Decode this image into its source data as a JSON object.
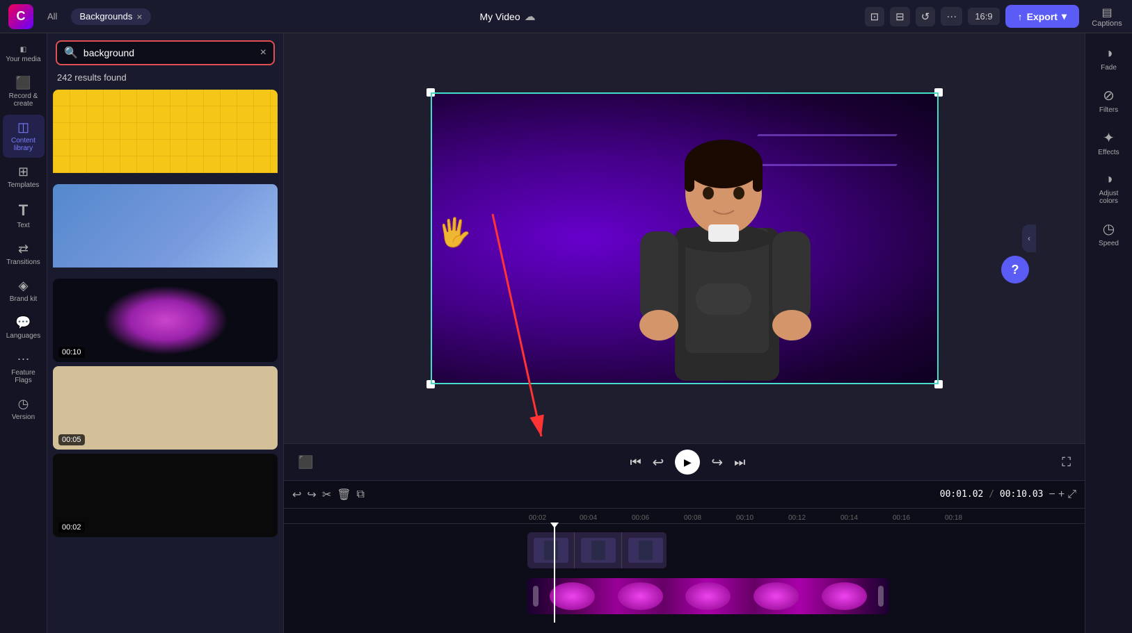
{
  "app": {
    "logo_text": "C",
    "title": "My Video",
    "export_label": "Export"
  },
  "tabs": {
    "all_label": "All",
    "backgrounds_label": "Backgrounds",
    "close_symbol": "×"
  },
  "search": {
    "placeholder": "background",
    "value": "background",
    "results_count": "242 results found",
    "clear_symbol": "×"
  },
  "sidebar": {
    "items": [
      {
        "id": "your-media",
        "label": "Your media",
        "icon": "▦"
      },
      {
        "id": "record-create",
        "label": "Record & create",
        "icon": "⬛"
      },
      {
        "id": "content-library",
        "label": "Content library",
        "icon": "◫"
      },
      {
        "id": "templates",
        "label": "Templates",
        "icon": "⊞"
      },
      {
        "id": "text",
        "label": "Text",
        "icon": "T"
      },
      {
        "id": "transitions",
        "label": "Transitions",
        "icon": "⇄"
      },
      {
        "id": "brand-kit",
        "label": "Brand kit",
        "icon": "◈"
      },
      {
        "id": "languages",
        "label": "Languages",
        "icon": "💬"
      },
      {
        "id": "feature-flags",
        "label": "Feature Flags",
        "icon": "⋯"
      },
      {
        "id": "version",
        "label": "Version",
        "icon": "◷"
      }
    ]
  },
  "right_panel": {
    "items": [
      {
        "id": "captions",
        "label": "Captions",
        "icon": "CC"
      },
      {
        "id": "fade",
        "label": "Fade",
        "icon": "◑"
      },
      {
        "id": "filters",
        "label": "Filters",
        "icon": "⊘"
      },
      {
        "id": "effects",
        "label": "Effects",
        "icon": "✦"
      },
      {
        "id": "adjust-colors",
        "label": "Adjust colors",
        "icon": "◑"
      },
      {
        "id": "speed",
        "label": "Speed",
        "icon": "◷"
      }
    ]
  },
  "media_cards": [
    {
      "id": "yellow-bg",
      "type": "yellow",
      "duration": null
    },
    {
      "id": "blue-bg",
      "type": "blue",
      "duration": null
    },
    {
      "id": "purple-bg",
      "type": "purple",
      "duration": "00:10"
    },
    {
      "id": "beige-bg",
      "type": "beige",
      "duration": "00:05"
    },
    {
      "id": "black-bg",
      "type": "black",
      "duration": "00:02"
    }
  ],
  "toolbar": {
    "aspect_ratio": "16:9",
    "crop_icon": "⊡",
    "cut_icon": "✂",
    "delete_icon": "🗑",
    "copy_icon": "⧉",
    "undo_icon": "↩",
    "redo_icon": "↪",
    "zoom_in": "+",
    "zoom_out": "−",
    "expand_icon": "⤢"
  },
  "timeline": {
    "current_time": "00:01.02",
    "total_time": "00:10.03",
    "ruler_marks": [
      "00:02",
      "00:04",
      "00:06",
      "00:08",
      "00:10",
      "00:12",
      "00:14",
      "00:16",
      "00:18"
    ]
  },
  "playback": {
    "skip_back": "⏮",
    "back_5": "↩",
    "play": "▶",
    "forward_5": "↪",
    "skip_next": "⏭",
    "subtitle": "⬛",
    "fullscreen": "⛶"
  }
}
